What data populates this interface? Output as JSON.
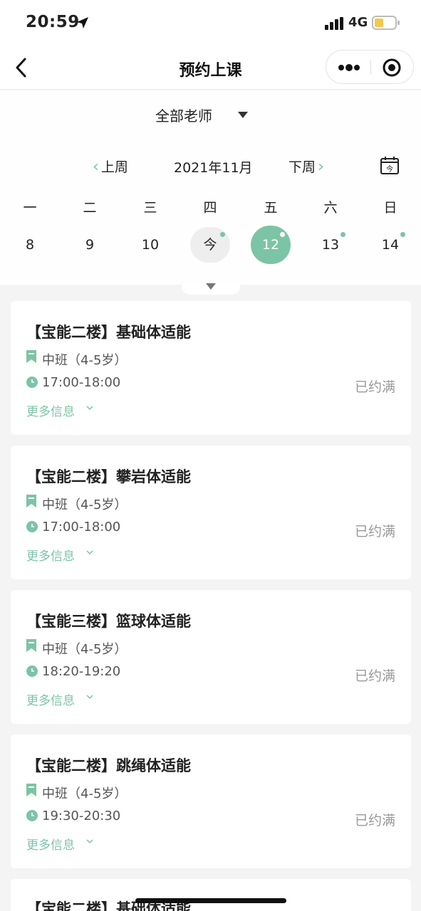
{
  "status_bar": {
    "time": "20:59",
    "network": "4G"
  },
  "nav": {
    "title": "预约上课"
  },
  "filter": {
    "teacher_select": "全部老师"
  },
  "calendar": {
    "prev_week": "上周",
    "month": "2021年11月",
    "next_week": "下周",
    "today_icon_char": "今",
    "weekdays": [
      "一",
      "二",
      "三",
      "四",
      "五",
      "六",
      "日"
    ],
    "days": [
      "8",
      "9",
      "10",
      "今",
      "12",
      "13",
      "14"
    ]
  },
  "colors": {
    "accent": "#7cc4a6",
    "background": "#f4f4f4"
  },
  "courses": [
    {
      "title": "【宝能二楼】基础体适能",
      "level": "中班（4-5岁）",
      "time": "17:00-18:00",
      "more": "更多信息",
      "status": "已约满"
    },
    {
      "title": "【宝能二楼】攀岩体适能",
      "level": "中班（4-5岁）",
      "time": "17:00-18:00",
      "more": "更多信息",
      "status": "已约满"
    },
    {
      "title": "【宝能三楼】篮球体适能",
      "level": "中班（4-5岁）",
      "time": "18:20-19:20",
      "more": "更多信息",
      "status": "已约满"
    },
    {
      "title": "【宝能二楼】跳绳体适能",
      "level": "中班（4-5岁）",
      "time": "19:30-20:30",
      "more": "更多信息",
      "status": "已约满"
    },
    {
      "title": "【宝能二楼】基础体适能"
    }
  ]
}
